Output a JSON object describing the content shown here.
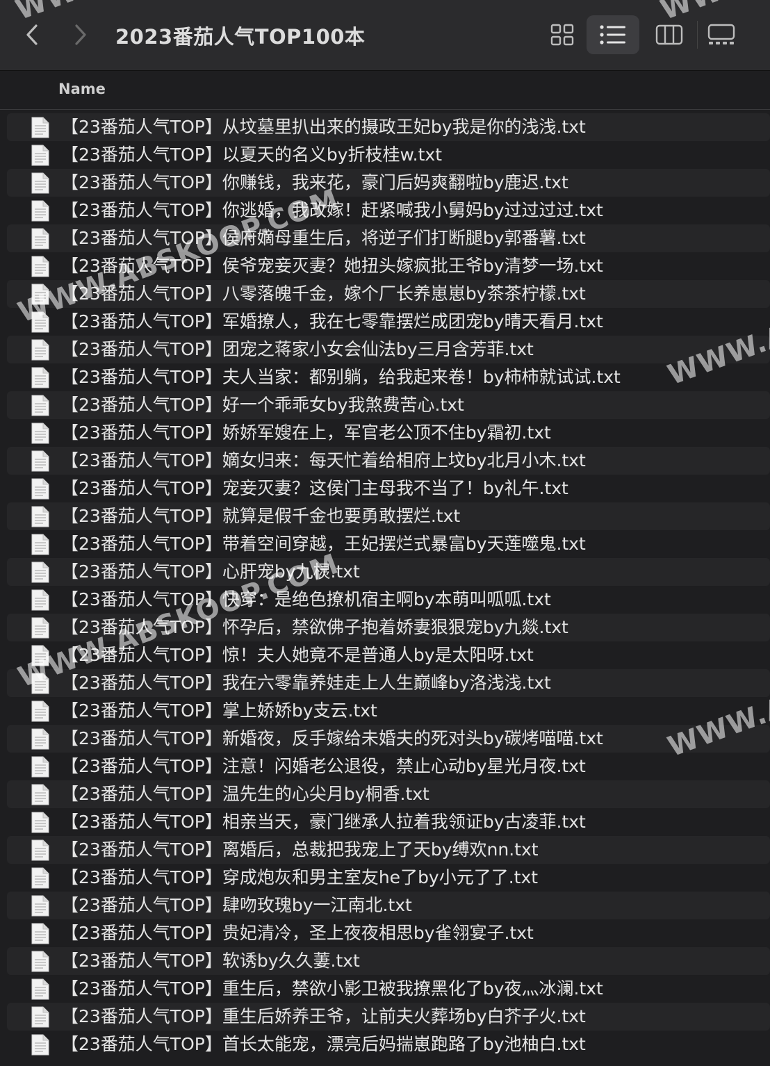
{
  "window": {
    "title": "2023番茄人气TOP100本"
  },
  "toolbar": {
    "back_icon": "chevron-left-icon",
    "forward_icon": "chevron-right-icon",
    "views": [
      "icon-view-icon",
      "list-view-icon",
      "column-view-icon",
      "gallery-view-icon"
    ],
    "selected_view": "list-view-icon"
  },
  "columns": {
    "name": "Name"
  },
  "files": [
    "【23番茄人气TOP】从坟墓里扒出来的摄政王妃by我是你的浅浅.txt",
    "【23番茄人气TOP】以夏天的名义by折枝桂w.txt",
    "【23番茄人气TOP】你赚钱，我来花，豪门后妈爽翻啦by鹿迟.txt",
    "【23番茄人气TOP】你逃婚，我改嫁！赶紧喊我小舅妈by过过过过.txt",
    "【23番茄人气TOP】侯府嫡母重生后，将逆子们打断腿by郭番薯.txt",
    "【23番茄人气TOP】侯爷宠妾灭妻？她扭头嫁疯批王爷by清梦一场.txt",
    "【23番茄人气TOP】八零落魄千金，嫁个厂长养崽崽by茶茶柠檬.txt",
    "【23番茄人气TOP】军婚撩人，我在七零靠摆烂成团宠by晴天看月.txt",
    "【23番茄人气TOP】团宠之蒋家小女会仙法by三月含芳菲.txt",
    "【23番茄人气TOP】夫人当家：都别躺，给我起来卷！by柿柿就试试.txt",
    "【23番茄人气TOP】好一个乖乖女by我煞费苦心.txt",
    "【23番茄人气TOP】娇娇军嫂在上，军官老公顶不住by霜初.txt",
    "【23番茄人气TOP】嫡女归来：每天忙着给相府上坟by北月小木.txt",
    "【23番茄人气TOP】宠妾灭妻？这侯门主母我不当了！by礼午.txt",
    "【23番茄人气TOP】就算是假千金也要勇敢摆烂.txt",
    "【23番茄人气TOP】带着空间穿越，王妃摆烂式暴富by天莲噬鬼.txt",
    "【23番茄人气TOP】心肝宠by九棂.txt",
    "【23番茄人气TOP】快穿：是绝色撩机宿主啊by本萌叫呱呱.txt",
    "【23番茄人气TOP】怀孕后，禁欲佛子抱着娇妻狠狠宠by九燚.txt",
    "【23番茄人气TOP】惊！夫人她竟不是普通人by是太阳呀.txt",
    "【23番茄人气TOP】我在六零靠养娃走上人生巅峰by洛浅浅.txt",
    "【23番茄人气TOP】掌上娇娇by支云.txt",
    "【23番茄人气TOP】新婚夜，反手嫁给未婚夫的死对头by碳烤喵喵.txt",
    "【23番茄人气TOP】注意！闪婚老公退役，禁止心动by星光月夜.txt",
    "【23番茄人气TOP】温先生的心尖月by桐香.txt",
    "【23番茄人气TOP】相亲当天，豪门继承人拉着我领证by古凌菲.txt",
    "【23番茄人气TOP】离婚后，总裁把我宠上了天by缚欢nn.txt",
    "【23番茄人气TOP】穿成炮灰和男主室友he了by小元了了.txt",
    "【23番茄人气TOP】肆吻玫瑰by一江南北.txt",
    "【23番茄人气TOP】贵妃清冷，圣上夜夜相思by雀翎宴子.txt",
    "【23番茄人气TOP】软诱by久久萋.txt",
    "【23番茄人气TOP】重生后，禁欲小影卫被我撩黑化了by夜灬冰澜.txt",
    "【23番茄人气TOP】重生后娇养王爷，让前夫火葬场by白芥子火.txt",
    "【23番茄人气TOP】首长太能宠，漂亮后妈揣崽跑路了by池柚白.txt"
  ],
  "file_icon": "text-document-icon",
  "watermark": {
    "text_1": "WWW.ABSKOOP.COM",
    "text_2": "WWW.A",
    "text_3": "WWW.A",
    "text_4": "WWW.ABSKOOP.COM",
    "text_5": "WWW.A",
    "text_top_left": "WW",
    "text_top_right": "WW"
  }
}
